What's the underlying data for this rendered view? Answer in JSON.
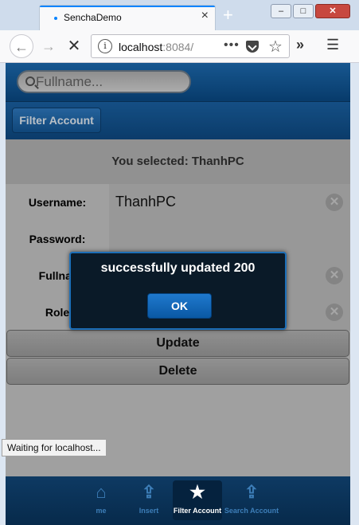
{
  "browser": {
    "tab_title": "SenchaDemo",
    "tab_close": "×",
    "new_tab": "+",
    "url_host": "localhost",
    "url_port": ":8084/",
    "url_dots": "•••",
    "window_buttons": [
      "‒",
      "□",
      "✕"
    ],
    "status_text": "Waiting for localhost..."
  },
  "app": {
    "search": {
      "placeholder": "Fullname..."
    },
    "toolbar": {
      "filter_label": "Filter Account"
    },
    "selected_text": "You selected: ThanhPC",
    "form": {
      "username_label": "Username:",
      "username_value": "ThanhPC",
      "password_label": "Password:",
      "fullname_label": "Fullnar",
      "role_label": "Role"
    },
    "update_label": "Update",
    "delete_label": "Delete",
    "bottom_tabs": [
      {
        "label": "me",
        "icon": "home-icon",
        "glyph": "⌂"
      },
      {
        "label": "Insert",
        "icon": "share-icon",
        "glyph": "⇪"
      },
      {
        "label": "Filter Account",
        "icon": "star-icon",
        "glyph": "★"
      },
      {
        "label": "Search Account",
        "icon": "share-icon",
        "glyph": "⇪"
      }
    ]
  },
  "dialog": {
    "message": "successfully updated 200",
    "ok_label": "OK"
  },
  "colors": {
    "accent": "#0a58a4",
    "header": "#0e4b85",
    "tab_accent": "#0a84ff"
  }
}
